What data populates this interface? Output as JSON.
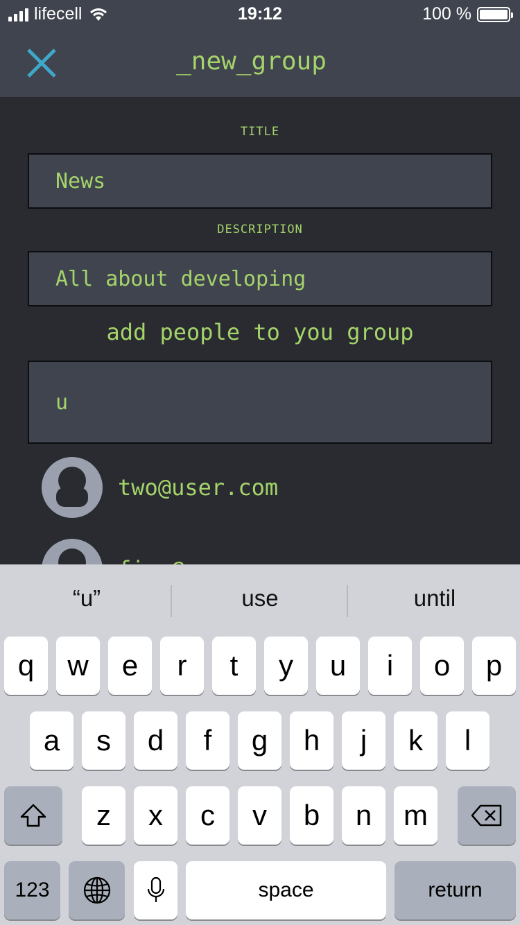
{
  "status_bar": {
    "carrier": "lifecell",
    "time": "19:12",
    "battery": "100 %"
  },
  "nav": {
    "title": "_new_group",
    "close_icon": "close-icon"
  },
  "form": {
    "title_label": "TITLE",
    "title_value": "News",
    "description_label": "DESCRIPTION",
    "description_value": "All about developing",
    "add_people_label": "add people to you group",
    "search_value": "u"
  },
  "users": [
    {
      "email": "two@user.com",
      "icon": "user-avatar-icon"
    },
    {
      "email": "five@user.com",
      "icon": "user-avatar-icon"
    }
  ],
  "keyboard": {
    "suggestions": [
      "“u”",
      "use",
      "until"
    ],
    "row1": [
      "q",
      "w",
      "e",
      "r",
      "t",
      "y",
      "u",
      "i",
      "o",
      "p"
    ],
    "row2": [
      "a",
      "s",
      "d",
      "f",
      "g",
      "h",
      "j",
      "k",
      "l"
    ],
    "row3": [
      "z",
      "x",
      "c",
      "v",
      "b",
      "n",
      "m"
    ],
    "numbers_label": "123",
    "space_label": "space",
    "return_label": "return",
    "icons": {
      "shift": "shift-icon",
      "backspace": "backspace-icon",
      "globe": "globe-icon",
      "mic": "microphone-icon"
    }
  },
  "colors": {
    "accent": "#a4d46a",
    "close_icon": "#3fa8c9",
    "header_bg": "#40444f",
    "page_bg": "#2a2b31"
  }
}
